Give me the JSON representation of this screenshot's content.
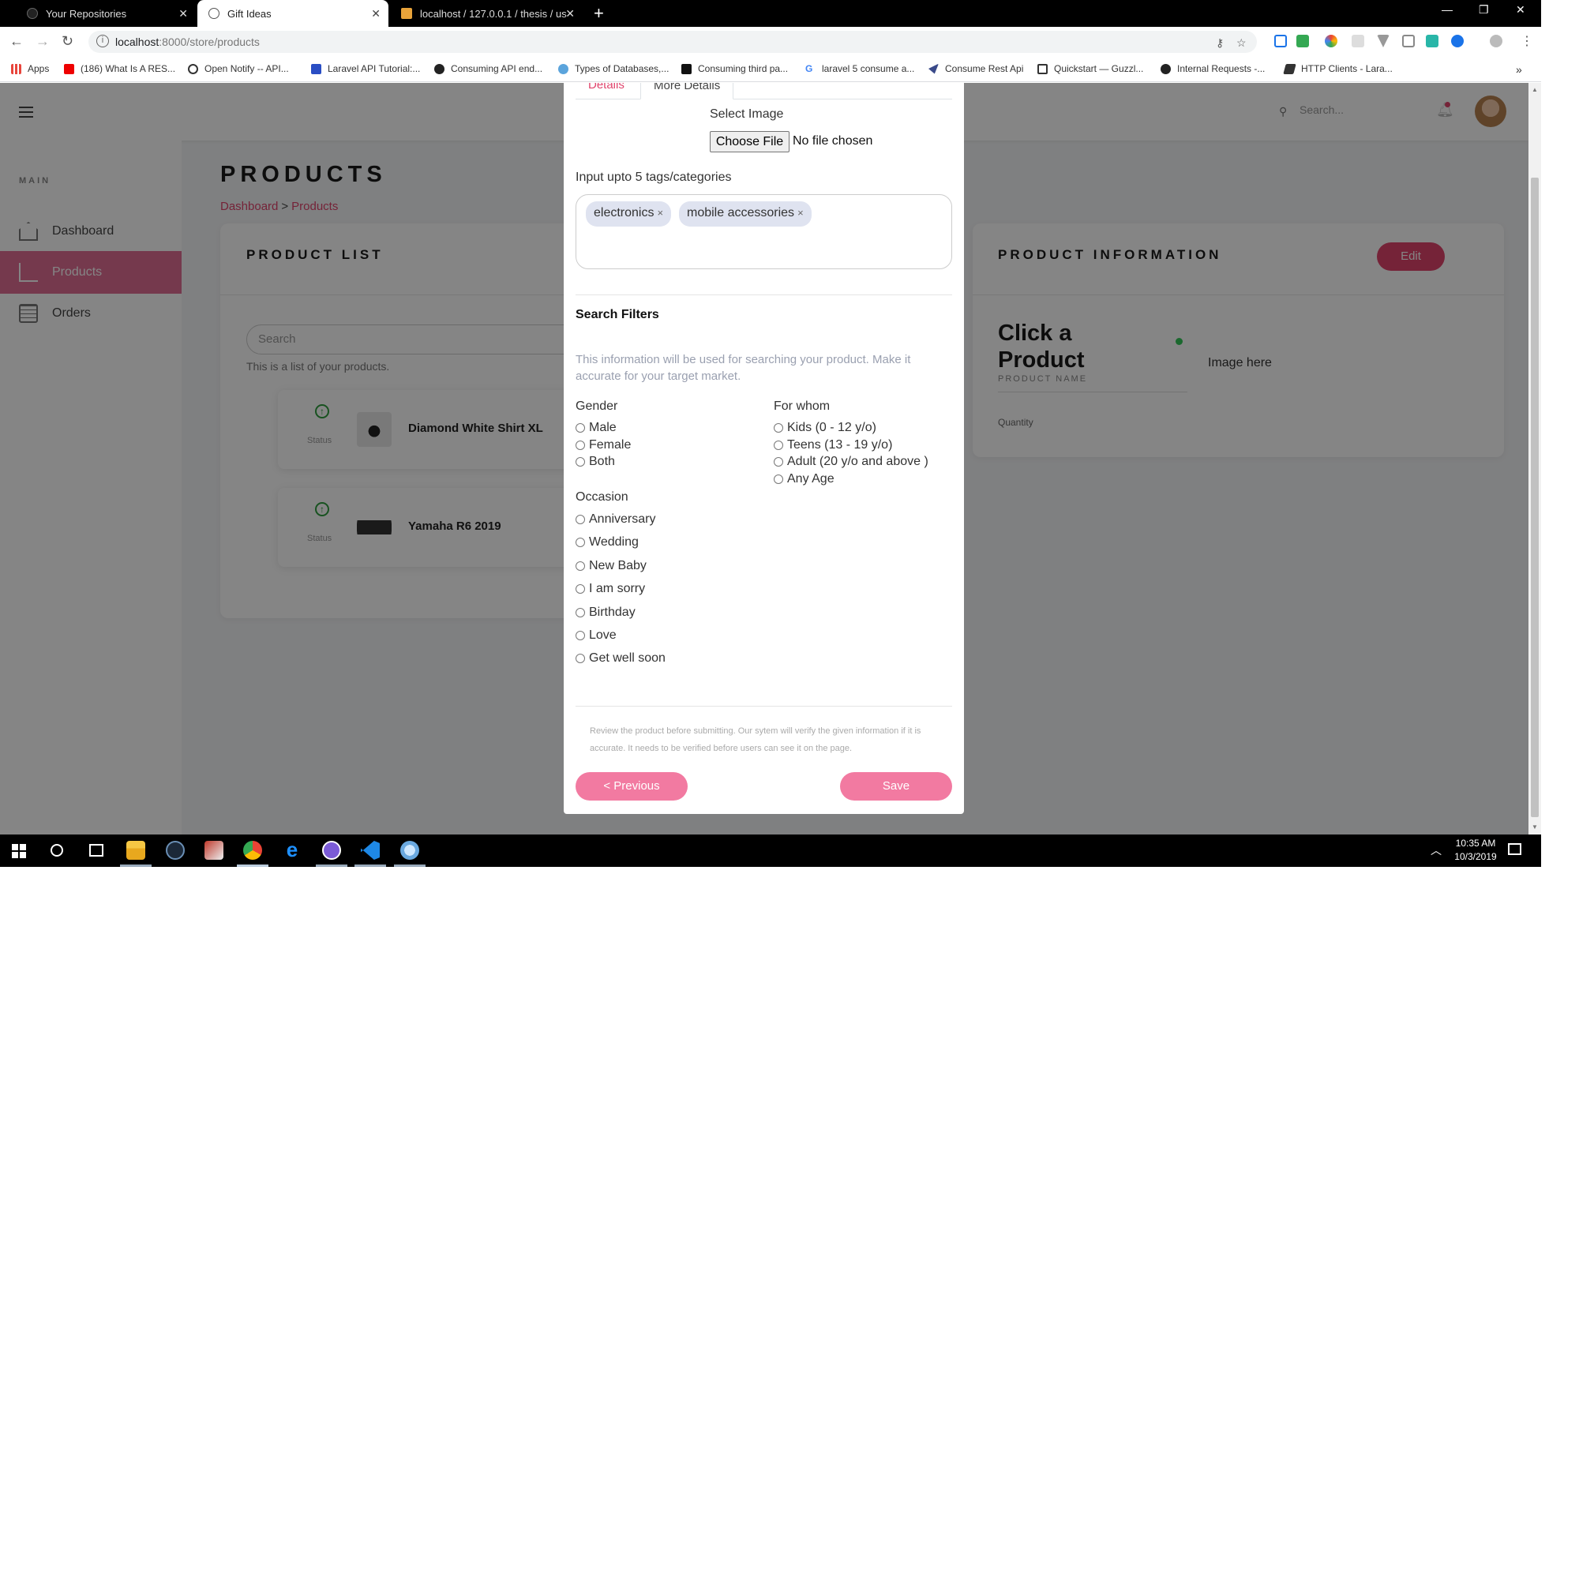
{
  "browser": {
    "tabs": [
      {
        "title": "Your Repositories"
      },
      {
        "title": "Gift Ideas"
      },
      {
        "title": "localhost / 127.0.0.1 / thesis / us"
      }
    ],
    "new_tab": "+",
    "url_host": "localhost",
    "url_path": ":8000/store/products",
    "bookmarks": [
      {
        "label": "Apps"
      },
      {
        "label": "(186) What Is A RES..."
      },
      {
        "label": "Open Notify -- API..."
      },
      {
        "label": "Laravel API Tutorial:..."
      },
      {
        "label": "Consuming API end..."
      },
      {
        "label": "Types of Databases,..."
      },
      {
        "label": "Consuming third pa..."
      },
      {
        "label": "laravel 5 consume a..."
      },
      {
        "label": "Consume Rest Api"
      },
      {
        "label": "Quickstart — Guzzl..."
      },
      {
        "label": "Internal Requests -..."
      },
      {
        "label": "HTTP Clients - Lara..."
      }
    ],
    "more_bookmarks": "»"
  },
  "app": {
    "search_placeholder": "Search...",
    "sidebar": {
      "section": "MAIN",
      "items": [
        {
          "label": "Dashboard"
        },
        {
          "label": "Products"
        },
        {
          "label": "Orders"
        }
      ]
    },
    "page_title": "PRODUCTS",
    "breadcrumb": {
      "home": "Dashboard",
      "separator": ">",
      "current": "Products"
    },
    "product_list": {
      "title": "PRODUCT LIST",
      "search_placeholder": "Search",
      "note": "This is a list of your products.",
      "items": [
        {
          "name": "Diamond White Shirt XL",
          "status_label": "Status"
        },
        {
          "name": "Yamaha R6 2019",
          "status_label": "Status"
        }
      ]
    },
    "product_info": {
      "title": "PRODUCT INFORMATION",
      "edit_label": "Edit",
      "heading": "Click a Product",
      "name_label": "PRODUCT NAME",
      "quantity_label": "Quantity",
      "image_placeholder": "Image here"
    }
  },
  "modal": {
    "tabs": [
      {
        "label": "Details"
      },
      {
        "label": "More Details"
      }
    ],
    "select_image_label": "Select Image",
    "choose_file_label": "Choose File",
    "no_file_label": "No file chosen",
    "tags_label": "Input upto 5 tags/categories",
    "tags": [
      {
        "label": "electronics",
        "remove": "×"
      },
      {
        "label": "mobile accessories",
        "remove": "×"
      }
    ],
    "filters_title": "Search Filters",
    "filters_desc": "This information will be used for searching your product. Make it accurate for your target market.",
    "gender": {
      "label": "Gender",
      "options": [
        "Male",
        "Female",
        "Both"
      ]
    },
    "for_whom": {
      "label": "For whom",
      "options": [
        "Kids (0 - 12 y/o)",
        "Teens (13 - 19 y/o)",
        "Adult (20 y/o and above )",
        "Any Age"
      ]
    },
    "occasion": {
      "label": "Occasion",
      "options": [
        "Anniversary",
        "Wedding",
        "New Baby",
        "I am sorry",
        "Birthday",
        "Love",
        "Get well soon"
      ]
    },
    "review_note": "Review the product before submitting. Our sytem will verify the given information if it is accurate. It needs to be verified before users can see it on the page.",
    "previous_label": "< Previous",
    "save_label": "Save"
  },
  "taskbar": {
    "time": "10:35 AM",
    "date": "10/3/2019"
  },
  "colors": {
    "accent": "#e0446c",
    "button_pink": "#f27aa1",
    "sidebar_active": "#e06e95",
    "status_green": "#2e9e3e"
  }
}
